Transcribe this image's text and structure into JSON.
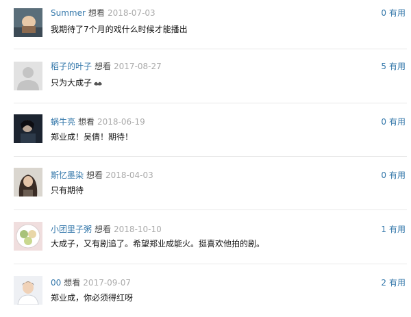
{
  "comments": [
    {
      "user": "Summer",
      "status": "想看",
      "date": "2018-07-03",
      "text": "我期待了7个月的戏什么时候才能播出",
      "votes": "0",
      "useful_label": "有用",
      "avatar": "anime-girl-avatar"
    },
    {
      "user": "稻子的叶子",
      "status": "想看",
      "date": "2017-08-27",
      "text": "只为大成子",
      "votes": "5",
      "useful_label": "有用",
      "avatar": "default-gray-avatar"
    },
    {
      "user": "蜗牛亮",
      "status": "想看",
      "date": "2018-06-19",
      "text": "郑业成！吴倩！期待！",
      "votes": "0",
      "useful_label": "有用",
      "avatar": "dark-portrait-avatar"
    },
    {
      "user": "斯忆墨染",
      "status": "想看",
      "date": "2018-04-03",
      "text": "只有期待",
      "votes": "0",
      "useful_label": "有用",
      "avatar": "long-hair-woman-avatar"
    },
    {
      "user": "小团里子粥",
      "status": "想看",
      "date": "2018-10-10",
      "text": "大成子，又有剧追了。希望郑业成能火。挺喜欢他拍的剧。",
      "votes": "1",
      "useful_label": "有用",
      "avatar": "food-plate-avatar"
    },
    {
      "user": "00",
      "status": "想看",
      "date": "2017-09-07",
      "text": "郑业成，你必须得红呀",
      "votes": "2",
      "useful_label": "有用",
      "avatar": "young-man-avatar"
    }
  ]
}
